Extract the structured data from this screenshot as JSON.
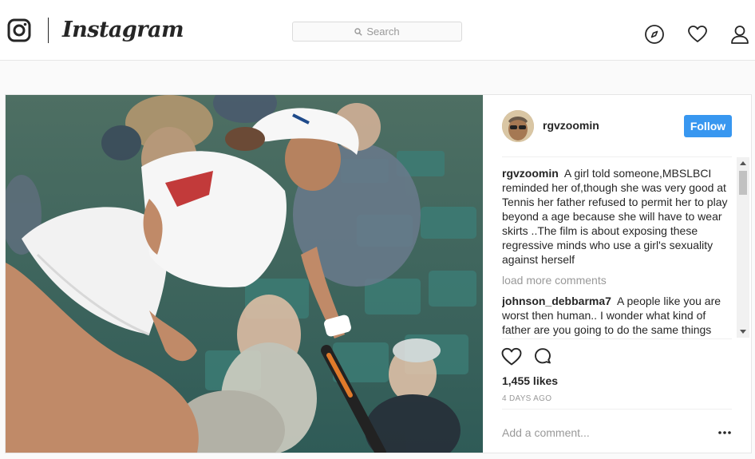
{
  "header": {
    "brand": "Instagram",
    "search_placeholder": "Search",
    "icons": [
      "instagram-camera-icon",
      "search-icon",
      "explore-compass-icon",
      "activity-heart-icon",
      "profile-person-icon"
    ]
  },
  "post": {
    "username": "rgvzoomin",
    "follow_label": "Follow",
    "caption": {
      "user": "rgvzoomin",
      "text": "A girl told someone,MBSLBCI reminded her of,though she was very good at Tennis her father refused to permit her to play beyond a age because she will have to wear skirts ..The film is about exposing these regressive minds who use a girl's sexuality against herself"
    },
    "load_more_label": "load more comments",
    "comments": [
      {
        "user": "johnson_debbarma7",
        "text": "A people like you are worst then human.. I wonder what kind of father are you going to do the same things"
      }
    ],
    "likes": "1,455 likes",
    "timestamp": "4 DAYS AGO",
    "add_comment_placeholder": "Add a comment...",
    "icons": [
      "like-heart-icon",
      "comment-bubble-icon",
      "more-options-icon"
    ]
  },
  "colors": {
    "follow_button": "#3897f0",
    "muted_text": "#999999",
    "text": "#262626",
    "border": "#e6e6e6"
  }
}
